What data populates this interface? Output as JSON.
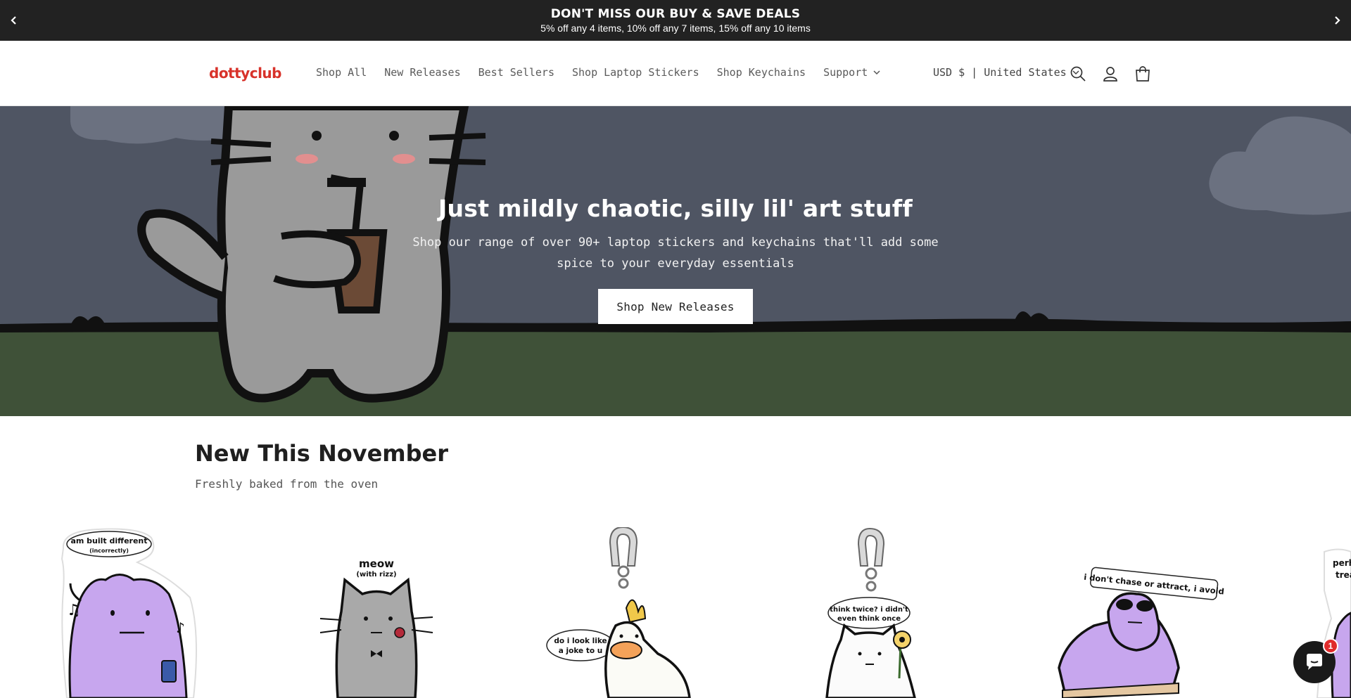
{
  "announcement": {
    "title": "DON'T MISS OUR BUY & SAVE DEALS",
    "subtitle": "5% off any 4 items, 10% off any 7 items, 15% off any 10 items"
  },
  "header": {
    "logo": "dottyclub",
    "nav": [
      "Shop All",
      "New Releases",
      "Best Sellers",
      "Shop Laptop Stickers",
      "Shop Keychains",
      "Support"
    ],
    "currency": "USD $ | United States"
  },
  "hero": {
    "title": "Just mildly chaotic, silly lil' art stuff",
    "subtitle": "Shop our range of over 90+ laptop stickers and keychains that'll add some spice to your everyday essentials",
    "button": "Shop New Releases"
  },
  "section": {
    "title": "New This November",
    "subtitle": "Freshly baked from the oven"
  },
  "products": [
    {
      "caption_line1": "am built different",
      "caption_line2": "(incorrectly)"
    },
    {
      "caption_line1": "meow",
      "caption_line2": "(with rizz)"
    },
    {
      "caption_line1": "do i look like",
      "caption_line2": "a joke to u"
    },
    {
      "caption_line1": "think twice? i didn't",
      "caption_line2": "even think once"
    },
    {
      "caption_line1": "i don't chase or attract, i avoid",
      "caption_line2": ""
    },
    {
      "caption_line1": "perh",
      "caption_line2": "trea"
    }
  ],
  "chat": {
    "badge": "1"
  },
  "colors": {
    "accent": "#d8322a",
    "announcement_bg": "#222222",
    "hero_bg": "#4f5563",
    "grass": "#3f5138"
  }
}
